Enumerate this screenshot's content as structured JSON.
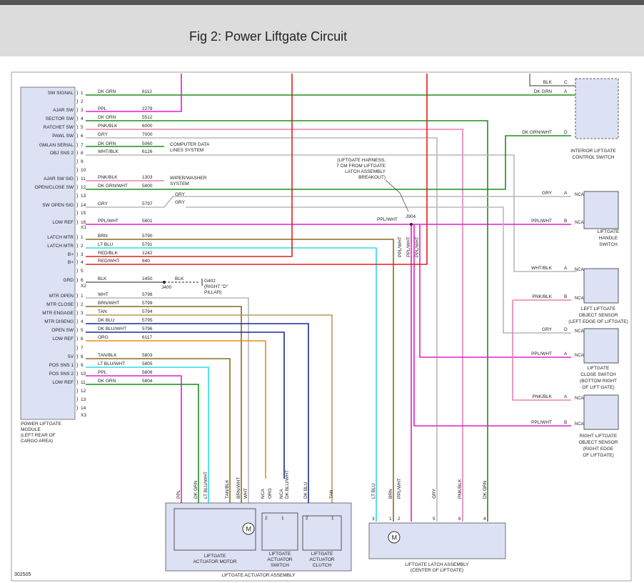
{
  "title": "Fig 2: Power Liftgate Circuit",
  "diagram_id": "302505",
  "colors": {
    "dk_grn": "#1a8f1a",
    "ppl": "#e020c8",
    "red": "#e0201a",
    "gry": "#b8b8b8",
    "lt_blu": "#30d8e8",
    "brn": "#8a6a20",
    "tan": "#b89a60",
    "dk_blu": "#1a2a9a",
    "org": "#f08a10",
    "pnk": "#e880b0"
  },
  "module": {
    "name_lines": [
      "POWER LIFTGATE",
      "MODULE",
      "(LEFT REAR OF",
      "CARGO AREA)"
    ],
    "connectors": [
      "X1",
      "X2",
      "X3"
    ],
    "x1_pins": [
      {
        "label": "SW SIGNAL",
        "pin": "1",
        "color": "DK GRN",
        "circuit": "6112"
      },
      {
        "label": "",
        "pin": "2",
        "color": "",
        "circuit": ""
      },
      {
        "label": "AJAR SW",
        "pin": "3",
        "color": "PPL",
        "circuit": "2279"
      },
      {
        "label": "SECTOR SW",
        "pin": "4",
        "color": "DK GRN",
        "circuit": "5512"
      },
      {
        "label": "RATCHET SW",
        "pin": "5",
        "color": "PNK/BLK",
        "circuit": "6000"
      },
      {
        "label": "PAWL SW",
        "pin": "6",
        "color": "GRY",
        "circuit": "7000"
      },
      {
        "label": "GMLAN SERIAL",
        "pin": "7",
        "color": "DK GRN",
        "circuit": "5060"
      },
      {
        "label": "OBJ SNS 2",
        "pin": "8",
        "color": "WHT/BLK",
        "circuit": "6126"
      },
      {
        "label": "",
        "pin": "9",
        "color": "",
        "circuit": ""
      },
      {
        "label": "",
        "pin": "10",
        "color": "",
        "circuit": ""
      },
      {
        "label": "AJAR SW SIG",
        "pin": "11",
        "color": "PNK/BLK",
        "circuit": "1303"
      },
      {
        "label": "OPEN/CLOSE SW",
        "pin": "12",
        "color": "DK GRN/WHT",
        "circuit": "5800"
      },
      {
        "label": "",
        "pin": "13",
        "color": "",
        "circuit": ""
      },
      {
        "label": "SW OPEN SIG",
        "pin": "14",
        "color": "GRY",
        "circuit": "5797"
      },
      {
        "label": "",
        "pin": "15",
        "color": "",
        "circuit": ""
      },
      {
        "label": "LOW REF",
        "pin": "16",
        "color": "PPL/WHT",
        "circuit": "5801"
      }
    ],
    "x2_pins": [
      {
        "label": "LATCH MTR",
        "pin": "1",
        "color": "BRN",
        "circuit": "5790"
      },
      {
        "label": "LATCH MTR",
        "pin": "2",
        "color": "LT BLU",
        "circuit": "5791"
      },
      {
        "label": "B+",
        "pin": "3",
        "color": "RED/BLK",
        "circuit": "1242"
      },
      {
        "label": "B+",
        "pin": "4",
        "color": "RED/WHT",
        "circuit": "840"
      },
      {
        "label": "",
        "pin": "5",
        "color": "",
        "circuit": ""
      },
      {
        "label": "GRD",
        "pin": "6",
        "color": "BLK",
        "circuit": "1450"
      }
    ],
    "x3_pins": [
      {
        "label": "MTR OPEN",
        "pin": "1",
        "color": "WHT",
        "circuit": "5798"
      },
      {
        "label": "MTR CLOSE",
        "pin": "2",
        "color": "BRN/WHT",
        "circuit": "5799"
      },
      {
        "label": "MTR ENGAGE",
        "pin": "3",
        "color": "TAN",
        "circuit": "5794"
      },
      {
        "label": "MTR DISENG",
        "pin": "4",
        "color": "DK BLU",
        "circuit": "5795"
      },
      {
        "label": "OPEN SW",
        "pin": "5",
        "color": "DK BLU/WHT",
        "circuit": "5796"
      },
      {
        "label": "LOW REF",
        "pin": "6",
        "color": "ORG",
        "circuit": "6117"
      },
      {
        "label": "",
        "pin": "7",
        "color": "",
        "circuit": ""
      },
      {
        "label": "5V",
        "pin": "8",
        "color": "TAN/BLK",
        "circuit": "5803"
      },
      {
        "label": "POS SNS 1",
        "pin": "9",
        "color": "LT BLU/WHT",
        "circuit": "5805"
      },
      {
        "label": "POS SNS 2",
        "pin": "10",
        "color": "PPL",
        "circuit": "5806"
      },
      {
        "label": "LOW REF",
        "pin": "11",
        "color": "DK GRN",
        "circuit": "5804"
      },
      {
        "label": "",
        "pin": "12",
        "color": "",
        "circuit": ""
      },
      {
        "label": "",
        "pin": "13",
        "color": "",
        "circuit": ""
      },
      {
        "label": "",
        "pin": "14",
        "color": "",
        "circuit": ""
      }
    ]
  },
  "notes": {
    "computer_data": [
      "COMPUTER DATA",
      "LINES SYSTEM"
    ],
    "wiper": [
      "WIPER/WASHER",
      "SYSTEM"
    ],
    "gry": "GRY",
    "harness": [
      "(LIFTGATE HARNESS,",
      "7 CM FROM LIFTGATE",
      "LATCH ASSEMBLY",
      "BREAKOUT)"
    ],
    "splice": "J904",
    "ground_splice": "J400",
    "ground": [
      "G402",
      "(RIGHT \"D\"",
      "PILLAR)"
    ],
    "blk": "BLK"
  },
  "right_components": {
    "interior_switch": {
      "name_lines": [
        "INTERIOR LIFTGATE",
        "CONTROL SWITCH"
      ],
      "pins": [
        {
          "pin": "C",
          "color": "BLK"
        },
        {
          "pin": "A",
          "color": "DK GRN"
        },
        {
          "pin": "D",
          "color": "DK GRN/WHT"
        }
      ]
    },
    "handle_switch": {
      "name_lines": [
        "LIFTGATE",
        "HANDLE",
        "SWITCH"
      ],
      "pins": [
        {
          "pin": "A",
          "color": "GRY"
        },
        {
          "pin": "B",
          "color": "PPL/WHT"
        }
      ],
      "nca": "NCA"
    },
    "left_sensor": {
      "name_lines": [
        "LEFT LIFTGATE",
        "OBJECT SENSOR",
        "(LEFT EDGE OF LIFTGATE)"
      ],
      "pins": [
        {
          "pin": "A",
          "color": "WHT/BLK"
        },
        {
          "pin": "B",
          "color": "PNK/BLK"
        }
      ],
      "nca": "NCA"
    },
    "close_switch": {
      "name_lines": [
        "LIFTGATE",
        "CLOSE SWITCH",
        "(BOTTOM RIGHT",
        "OF LIFT GATE)"
      ],
      "pins": [
        {
          "pin": "D",
          "color": "GRY"
        },
        {
          "pin": "A",
          "color": "PPL/WHT"
        }
      ],
      "nca": "NCA"
    },
    "right_sensor": {
      "name_lines": [
        "RIGHT LIFTGATE",
        "OBJECT SENSOR",
        "(RIGHT EDGE",
        "OF LIFTGATE)"
      ],
      "pins": [
        {
          "pin": "A",
          "color": "PNK/BLK"
        },
        {
          "pin": "B",
          "color": "PPL/WHT"
        }
      ],
      "nca": "NCA"
    }
  },
  "actuator_assembly": {
    "name": "LIFTGATE ACTUATOR ASSEMBLY",
    "motor": [
      "LIFTGATE",
      "ACTUATOR MOTOR"
    ],
    "switch": [
      "LIFTGATE",
      "ACTUATOR",
      "SWITCH"
    ],
    "clutch": [
      "LIFTGATE",
      "ACTUATOR",
      "CLUTCH"
    ],
    "motor_symbol": "M",
    "wire_labels": [
      "PPL",
      "DK GRN",
      "LT BLU/WHT",
      "TAN/BLK",
      "BRN/WHT",
      "WHT",
      "NCA",
      "ORG",
      "NCA",
      "DK BLU/WHT",
      "DK BLU",
      "TAN"
    ],
    "pins": [
      "2",
      "1",
      "2",
      "1"
    ]
  },
  "latch_assembly": {
    "name": [
      "LIFTGATE LATCH ASSEMBLY",
      "(CENTER OF LIFTGATE)"
    ],
    "motor_symbol": "M",
    "wire_labels": [
      "LT BLU",
      "BRN",
      "PPL/WHT",
      "GRY",
      "PNK/BLK",
      "DK GRN"
    ],
    "pins": [
      "3",
      "1",
      "2",
      "5",
      "6",
      "4"
    ],
    "splice_labels": [
      "PPL/WHT",
      "PPL/WHT",
      "PPL/WHT"
    ]
  }
}
